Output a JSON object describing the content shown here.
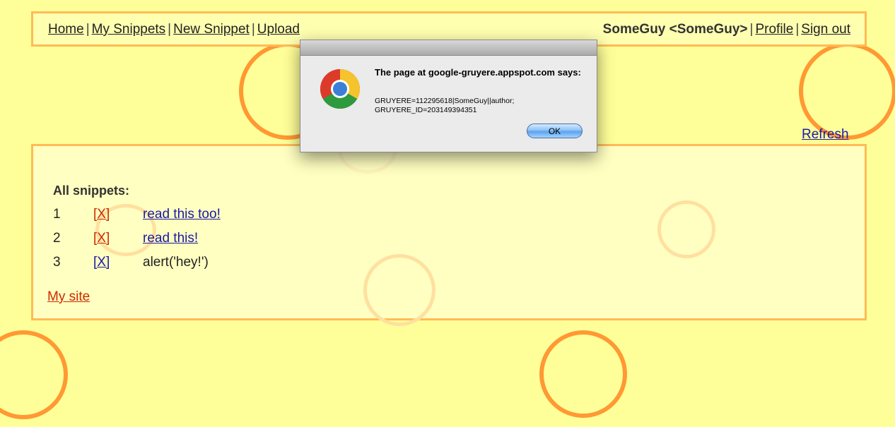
{
  "menu": {
    "home": "Home",
    "my_snippets": "My Snippets",
    "new_snippet": "New Snippet",
    "upload": "Upload",
    "separator": "|",
    "user": "SomeGuy <SomeGuy>",
    "profile": "Profile",
    "sign_out": "Sign out"
  },
  "refresh": "Refresh",
  "snippets": {
    "title": "All snippets:",
    "rows": [
      {
        "num": "1",
        "delete": "[X]",
        "text": "read this too!"
      },
      {
        "num": "2",
        "delete": "[X]",
        "text": "read this!"
      },
      {
        "num": "3",
        "delete": "[X]",
        "text": "alert('hey!')"
      }
    ],
    "my_site": "My site"
  },
  "dialog": {
    "title": "The page at google-gruyere.appspot.com says:",
    "message_line1": "GRUYERE=112295618|SomeGuy||author;",
    "message_line2": "GRUYERE_ID=203149394351",
    "ok": "OK",
    "icon": "chrome-icon"
  },
  "colors": {
    "background": "#ffff99",
    "border": "#ffbb55",
    "circle": "#ff9933",
    "link_blue": "#1a1aa6",
    "link_red": "#cc2a00"
  }
}
